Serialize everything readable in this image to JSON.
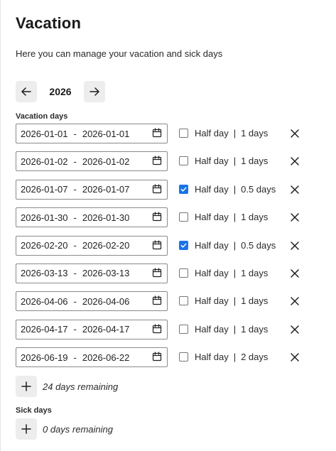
{
  "page": {
    "title": "Vacation",
    "subtitle": "Here you can manage your vacation and sick days"
  },
  "year_nav": {
    "prev_icon": "arrow-left-icon",
    "year": "2026",
    "next_icon": "arrow-right-icon"
  },
  "vacation": {
    "label": "Vacation days",
    "separator": "-",
    "half_day_label": "Half day",
    "pipe": "|",
    "rows": [
      {
        "start": "2026-01-01",
        "end": "2026-01-01",
        "half_day": false,
        "days": "1 days"
      },
      {
        "start": "2026-01-02",
        "end": "2026-01-02",
        "half_day": false,
        "days": "1 days"
      },
      {
        "start": "2026-01-07",
        "end": "2026-01-07",
        "half_day": true,
        "days": "0.5 days"
      },
      {
        "start": "2026-01-30",
        "end": "2026-01-30",
        "half_day": false,
        "days": "1 days"
      },
      {
        "start": "2026-02-20",
        "end": "2026-02-20",
        "half_day": true,
        "days": "0.5 days"
      },
      {
        "start": "2026-03-13",
        "end": "2026-03-13",
        "half_day": false,
        "days": "1 days"
      },
      {
        "start": "2026-04-06",
        "end": "2026-04-06",
        "half_day": false,
        "days": "1 days"
      },
      {
        "start": "2026-04-17",
        "end": "2026-04-17",
        "half_day": false,
        "days": "1 days"
      },
      {
        "start": "2026-06-19",
        "end": "2026-06-22",
        "half_day": false,
        "days": "2 days"
      }
    ],
    "remaining": "24 days remaining"
  },
  "sick": {
    "label": "Sick days",
    "remaining": "0 days remaining"
  },
  "colors": {
    "accent": "#1a73e8",
    "button_bg": "#ededed"
  }
}
